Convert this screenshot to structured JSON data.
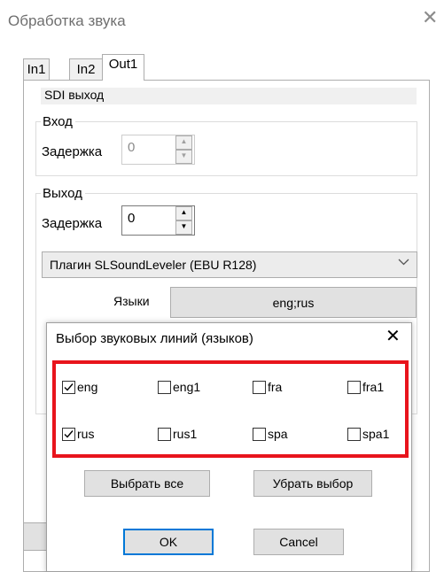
{
  "window": {
    "title": "Обработка звука",
    "close_glyph": "✕"
  },
  "tabs": [
    {
      "label": "In1"
    },
    {
      "label": "In2"
    },
    {
      "label": "Out1",
      "active": true
    }
  ],
  "panel": {
    "sdi_header": "SDI выход",
    "input_group": {
      "title": "Вход",
      "delay_label": "Задержка",
      "delay_value": "0",
      "enabled": false
    },
    "output_group": {
      "title": "Выход",
      "delay_label": "Задержка",
      "delay_value": "0",
      "plugin_selected": "Плагин SLSoundLeveler (EBU R128)",
      "languages_label": "Языки",
      "languages_value": "eng;rus"
    }
  },
  "dialog": {
    "title": "Выбор звуковых линий (языков)",
    "close_glyph": "✕",
    "languages": [
      {
        "label": "eng",
        "checked": true
      },
      {
        "label": "eng1",
        "checked": false
      },
      {
        "label": "fra",
        "checked": false
      },
      {
        "label": "fra1",
        "checked": false
      },
      {
        "label": "rus",
        "checked": true
      },
      {
        "label": "rus1",
        "checked": false
      },
      {
        "label": "spa",
        "checked": false
      },
      {
        "label": "spa1",
        "checked": false
      }
    ],
    "select_all_label": "Выбрать все",
    "clear_label": "Убрать выбор",
    "ok_label": "OK",
    "cancel_label": "Cancel",
    "highlight_color": "#e8141c"
  },
  "icons": {
    "chevron": "chevron-down-icon",
    "spin_up": "arrow-up-icon",
    "spin_down": "arrow-down-icon",
    "check": "checkmark-icon"
  }
}
